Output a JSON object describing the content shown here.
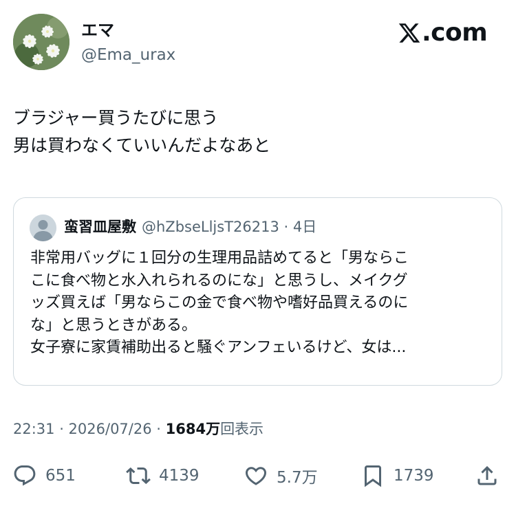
{
  "author": {
    "display_name": "エマ",
    "handle": "@Ema_urax"
  },
  "brand": {
    "label": ".com",
    "icon": "x-logo-icon"
  },
  "tweet": {
    "lines": [
      "ブラジャー買うたびに思う",
      "男は買わなくていいんだよなあと"
    ]
  },
  "quote": {
    "name": "蛮習皿屋敷",
    "meta": "@hZbseLljsT26213 · 4日",
    "lines": [
      "非常用バッグに１回分の生理用品詰めてると「男ならこ",
      "こに食べ物と水入れられるのにな」と思うし、メイクグ",
      "ッズ買えば「男ならこの金で食べ物や嗜好品買えるのに",
      "な」と思うときがある。",
      "女子寮に家賃補助出ると騒ぐアンフェいるけど、女は..."
    ]
  },
  "timestamp": {
    "time_date": "22:31 · 2026/07/26 · ",
    "views_count": "1684",
    "views_unit": "万",
    "views_label": "回表示"
  },
  "actions": {
    "replies": "651",
    "retweets": "4139",
    "likes": "5.7万",
    "bookmarks": "1739"
  }
}
